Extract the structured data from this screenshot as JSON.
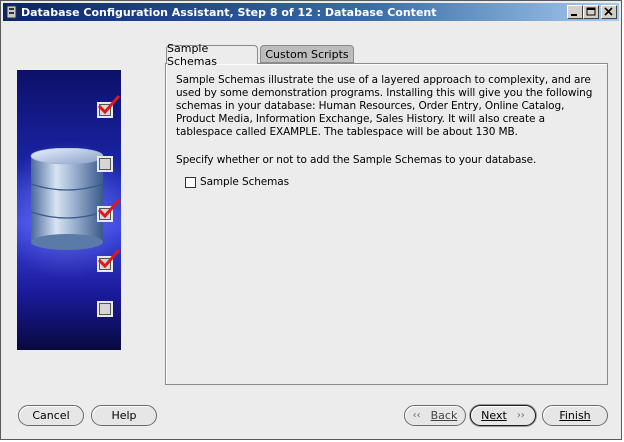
{
  "window": {
    "title": "Database Configuration Assistant, Step 8 of 12 : Database Content",
    "buttons": {
      "minimize_icon": "minimize-icon",
      "maximize_icon": "maximize-icon",
      "close_icon": "close-icon"
    }
  },
  "tabs": [
    {
      "label": "Sample Schemas",
      "active": true
    },
    {
      "label": "Custom Scripts",
      "active": false
    }
  ],
  "content": {
    "description": "Sample Schemas illustrate the use of a layered approach to complexity, and are used by some demonstration programs. Installing this will give you the following schemas in your database: Human Resources, Order Entry, Online Catalog, Product Media, Information Exchange, Sales History. It will also create a tablespace called EXAMPLE. The tablespace will be about 130 MB.",
    "prompt": "Specify whether or not to add the Sample Schemas to your database.",
    "checkbox": {
      "label": "Sample Schemas",
      "checked": false
    }
  },
  "side_panel": {
    "steps": [
      {
        "state": "checked"
      },
      {
        "state": "unchecked"
      },
      {
        "state": "checked"
      },
      {
        "state": "checked"
      },
      {
        "state": "unchecked"
      }
    ],
    "accent_color": "#1a24a8"
  },
  "buttons": {
    "cancel": "Cancel",
    "help": "Help",
    "back": "Back",
    "next": "Next",
    "finish": "Finish"
  }
}
